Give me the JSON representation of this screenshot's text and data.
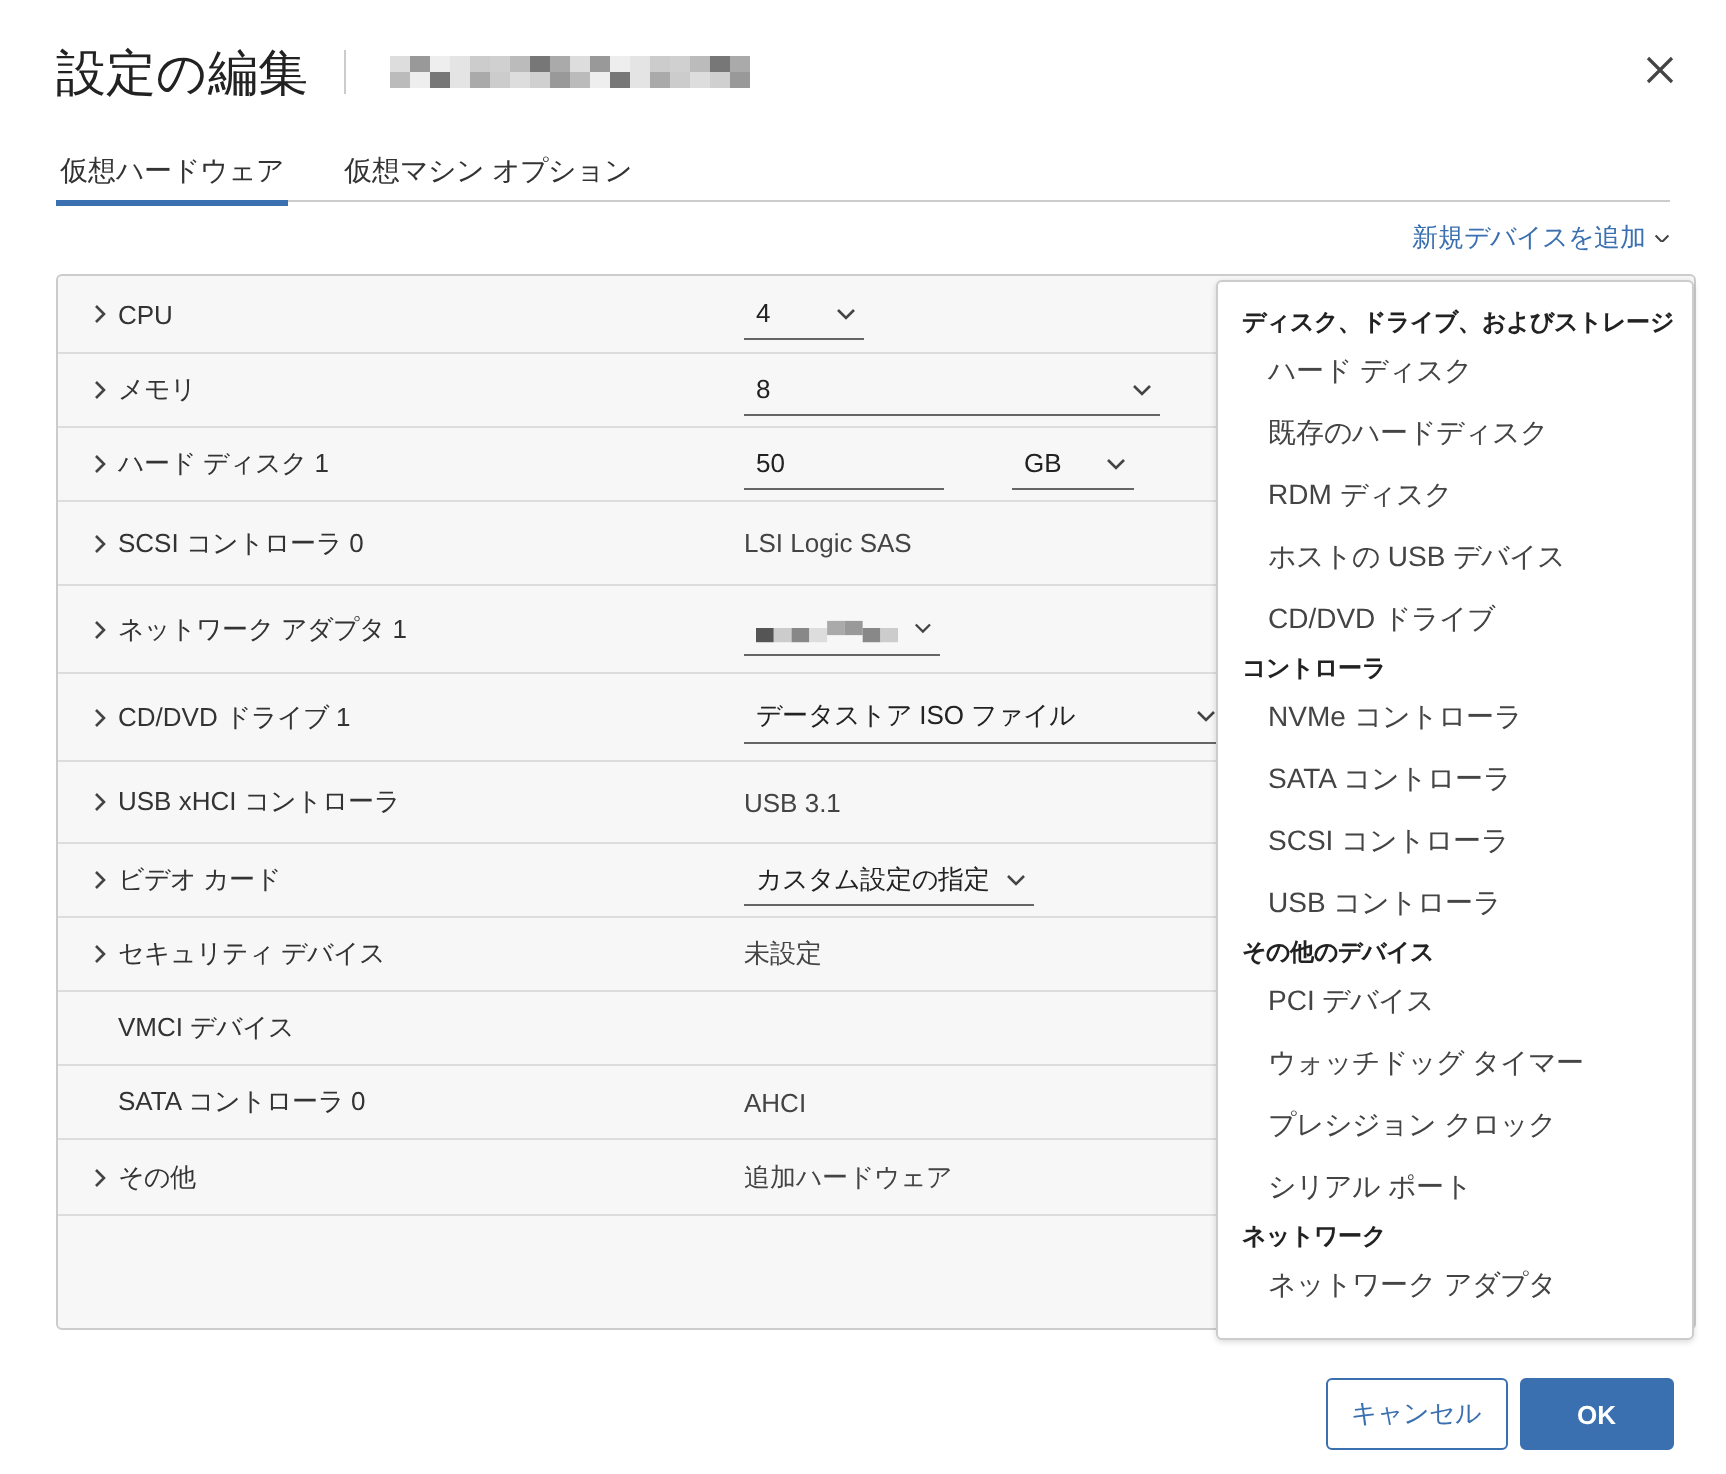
{
  "dialog": {
    "title": "設定の編集"
  },
  "tabs": [
    {
      "label": "仮想ハードウェア",
      "selected": true
    },
    {
      "label": "仮想マシン オプション",
      "selected": false
    }
  ],
  "add_device": {
    "label": "新規デバイスを追加"
  },
  "hardware_rows": [
    {
      "label": "CPU",
      "expandable": true,
      "kind": "select",
      "value": "4"
    },
    {
      "label": "メモリ",
      "expandable": true,
      "kind": "select",
      "value": "8"
    },
    {
      "label": "ハード ディスク 1",
      "expandable": true,
      "kind": "input_unit",
      "value": "50",
      "unit": "GB"
    },
    {
      "label": "SCSI コントローラ 0",
      "expandable": true,
      "kind": "text",
      "value": "LSI Logic SAS"
    },
    {
      "label": "ネットワーク アダプタ 1",
      "expandable": true,
      "kind": "masked_select"
    },
    {
      "label": "CD/DVD ドライブ 1",
      "expandable": true,
      "kind": "select",
      "value": "データストア ISO ファイル"
    },
    {
      "label": "USB xHCI コントローラ",
      "expandable": true,
      "kind": "text",
      "value": "USB 3.1"
    },
    {
      "label": "ビデオ カード",
      "expandable": true,
      "kind": "select",
      "value": "カスタム設定の指定"
    },
    {
      "label": "セキュリティ デバイス",
      "expandable": true,
      "kind": "text",
      "value": "未設定"
    },
    {
      "label": "VMCI デバイス",
      "expandable": false,
      "kind": "none"
    },
    {
      "label": "SATA コントローラ 0",
      "expandable": false,
      "kind": "text",
      "value": "AHCI"
    },
    {
      "label": "その他",
      "expandable": true,
      "kind": "text",
      "value": "追加ハードウェア"
    }
  ],
  "device_menu": [
    {
      "heading": "ディスク、ドライブ、およびストレージ",
      "items": [
        "ハード ディスク",
        "既存のハードディスク",
        "RDM ディスク",
        "ホストの USB デバイス",
        "CD/DVD ドライブ"
      ]
    },
    {
      "heading": "コントローラ",
      "items": [
        "NVMe コントローラ",
        "SATA コントローラ",
        "SCSI コントローラ",
        "USB コントローラ"
      ]
    },
    {
      "heading": "その他のデバイス",
      "items": [
        "PCI デバイス",
        "ウォッチドッグ タイマー",
        "プレシジョン クロック",
        "シリアル ポート"
      ]
    },
    {
      "heading": "ネットワーク",
      "items": [
        "ネットワーク アダプタ"
      ]
    }
  ],
  "buttons": [
    {
      "label": "キャンセル",
      "kind": "secondary"
    },
    {
      "label": "OK",
      "kind": "primary"
    }
  ]
}
